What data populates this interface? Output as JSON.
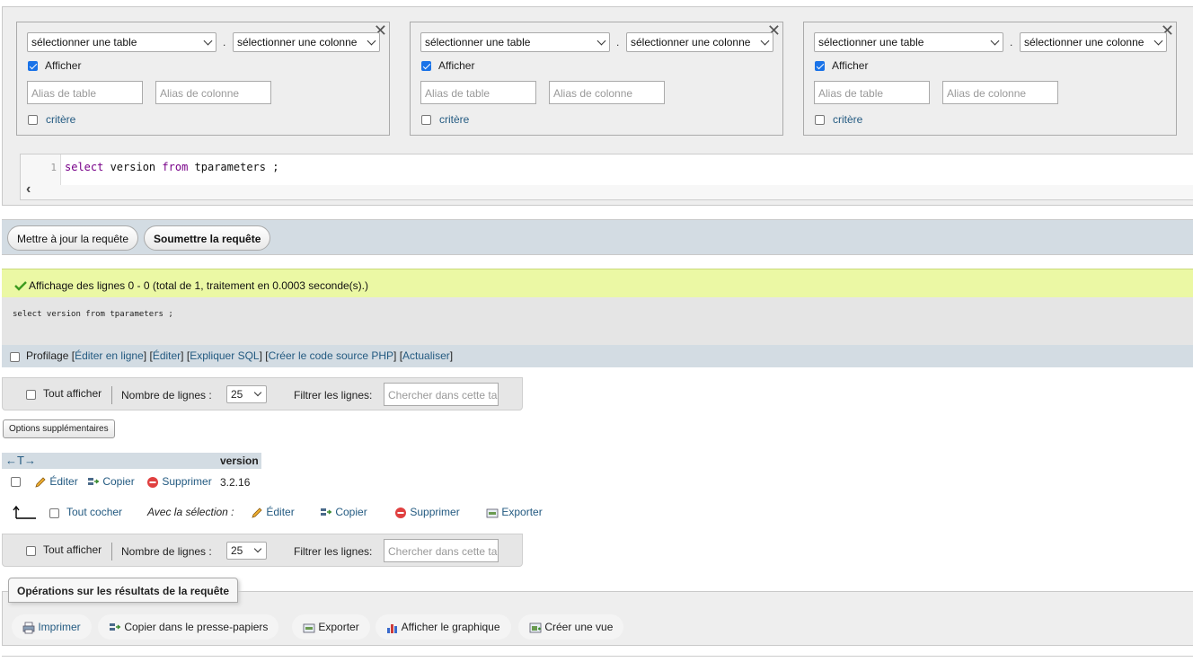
{
  "builder": {
    "columns": [
      {
        "table_select": "sélectionner une table",
        "column_select": "sélectionner une colonne",
        "show_label": "Afficher",
        "show_checked": true,
        "table_alias_placeholder": "Alias de table",
        "column_alias_placeholder": "Alias de colonne",
        "criteria_label": "critère"
      },
      {
        "table_select": "sélectionner une table",
        "column_select": "sélectionner une colonne",
        "show_label": "Afficher",
        "show_checked": true,
        "table_alias_placeholder": "Alias de table",
        "column_alias_placeholder": "Alias de colonne",
        "criteria_label": "critère"
      },
      {
        "table_select": "sélectionner une table",
        "column_select": "sélectionner une colonne",
        "show_label": "Afficher",
        "show_checked": true,
        "table_alias_placeholder": "Alias de table",
        "column_alias_placeholder": "Alias de colonne",
        "criteria_label": "critère"
      }
    ],
    "dot": ".",
    "close_glyph": "✕"
  },
  "editor": {
    "line_number": "1",
    "kw_select": "select",
    "t_version": " version ",
    "kw_from": "from",
    "t_rest": " tparameters ;",
    "scroll_glyph": "‹"
  },
  "actions": {
    "update_query": "Mettre à jour la requête",
    "submit_query": "Soumettre la requête"
  },
  "result": {
    "success_message": "Affichage des lignes 0 - 0 (total de 1, traitement en 0.0003 seconde(s).)",
    "sql_text": "select version from tparameters ;",
    "profiling_label": "Profilage",
    "links": [
      "Éditer en ligne",
      "Éditer",
      "Expliquer SQL",
      "Créer le code source PHP",
      "Actualiser"
    ],
    "bracket_open": "[",
    "bracket_close": "]"
  },
  "nav": {
    "show_all": "Tout afficher",
    "rows_label": "Nombre de lignes :",
    "rows_value": "25",
    "filter_label": "Filtrer les lignes:",
    "filter_placeholder": "Chercher dans cette table"
  },
  "extra_options": "Options supplémentaires",
  "table": {
    "arrows": "←T→",
    "header": "version",
    "rows": [
      {
        "edit": "Éditer",
        "copy": "Copier",
        "delete": "Supprimer",
        "value": "3.2.16"
      }
    ]
  },
  "bulk": {
    "check_all": "Tout cocher",
    "with_selection": "Avec la sélection :",
    "edit": "Éditer",
    "copy": "Copier",
    "delete": "Supprimer",
    "export": "Exporter"
  },
  "operations": {
    "legend": "Opérations sur les résultats de la requête",
    "print": "Imprimer",
    "copy_clipboard": "Copier dans le presse-papiers",
    "export": "Exporter",
    "chart": "Afficher le graphique",
    "create_view": "Créer une vue"
  }
}
